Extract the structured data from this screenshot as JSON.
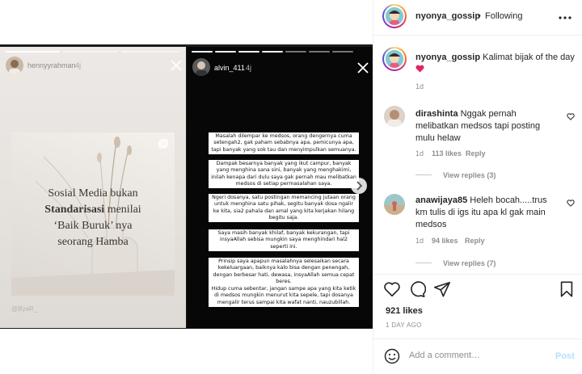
{
  "colors": {
    "accent": "#0095f6",
    "post_disabled": "#b2dffc",
    "heart_red": "#ed4956",
    "secondary_text": "#8e8e8e"
  },
  "story_left": {
    "username": "hennyyrahman",
    "time": "4j",
    "quote_line1": "Sosial Media bukan",
    "quote_bold": "Standarisasi",
    "quote_line2_rest": "menilai",
    "quote_line3": "‘Baik Buruk’ nya",
    "quote_line4": "seorang Hamba",
    "credit": "@ByaR_",
    "close_icon": "close-icon"
  },
  "story_right": {
    "username": "alvin_411",
    "time": "4j",
    "close_icon": "close-icon",
    "paragraphs": [
      "Masalah dilempar ke medsos, orang dengernya cuma setengah2, gak paham sebabnya apa, pemicunya apa, tapi banyak yang sok tau dan menyimpulkan semuanya.",
      "Dampak besarnya banyak yang ikut campur, banyak yang menghina sana sini, banyak yang menghakimi, inilah kenapa dari dulu saya gak pernah mau melibatkan medsos di setiap permasalahan saya.",
      "Ngeri dosanya, satu postingan memancing jutaan orang untuk menghina satu pihak, segitu banyak dosa ngalir ke kita, sia2 pahala dan amal yang kita kerjakan hilang begitu saja.",
      "Saya masih banyak khilaf, banyak kekurangan, tapi insyaAllah sebisa mungkin saya menghindari hal2 seperti ini.",
      "Prinsip saya apapun masalahnya selesaikan secara kekeluargaan, baiknya kalo bisa dengan penengah, dengan berbesar hati, dewasa, insyaAllah semua cepat beres.",
      "Hidup cuma sebentar, jangan sampe apa yang kita ketik di medsos mungkin menurut kita sepele, tapi dosanya mengalir terus sampai kita wafat nanti, nauzubillah."
    ]
  },
  "header": {
    "username": "nyonya_gossip",
    "dot": "•",
    "follow_status": "Following",
    "more_icon": "more-icon"
  },
  "caption": {
    "username": "nyonya_gossip",
    "text": "Kalimat bijak of the day",
    "emoji": "heart-emoji",
    "time": "1d"
  },
  "comments": [
    {
      "username": "dirashinta",
      "text": "Nggak pernah melibatkan medsos tapi posting mulu helaw",
      "time": "1d",
      "likes": "113 likes",
      "reply": "Reply",
      "view_replies": "View replies (3)"
    },
    {
      "username": "anawijaya85",
      "text": "Heleh bocah.....trus km tulis di igs itu apa kl gak main medsos",
      "time": "1d",
      "likes": "94 likes",
      "reply": "Reply",
      "view_replies": "View replies (7)"
    }
  ],
  "actions": {
    "like_icon": "heart-icon",
    "comment_icon": "comment-icon",
    "share_icon": "share-icon",
    "save_icon": "bookmark-icon"
  },
  "likes": "921 likes",
  "posted": "1 DAY AGO",
  "add_comment": {
    "emoji_icon": "emoji-icon",
    "placeholder": "Add a comment…",
    "post_label": "Post"
  }
}
